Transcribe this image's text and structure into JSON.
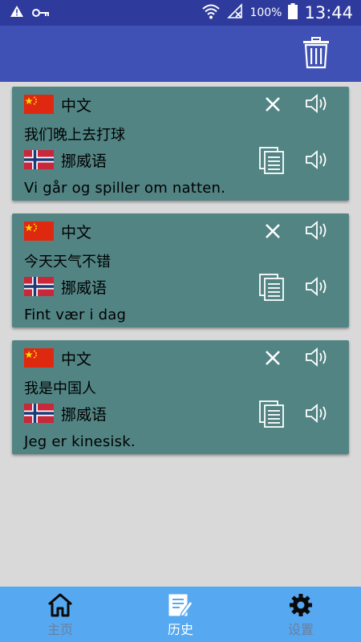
{
  "status_bar": {
    "battery": "100%",
    "time": "13:44",
    "icons": [
      "warning-icon",
      "key-icon",
      "wifi-icon",
      "no-signal-icon",
      "battery-icon"
    ]
  },
  "toolbar": {
    "icons": [
      "trash-icon"
    ]
  },
  "history": [
    {
      "source_lang": "中文",
      "source_text": "我们晚上去打球",
      "target_lang": "挪威语",
      "target_text": "Vi går og spiller om natten."
    },
    {
      "source_lang": "中文",
      "source_text": "今天天气不错",
      "target_lang": "挪威语",
      "target_text": "Fint vær i dag"
    },
    {
      "source_lang": "中文",
      "source_text": "我是中国人",
      "target_lang": "挪威语",
      "target_text": "Jeg er kinesisk."
    }
  ],
  "bottom_nav": {
    "items": [
      {
        "label": "主页",
        "icon": "home-icon",
        "active": false
      },
      {
        "label": "历史",
        "icon": "history-icon",
        "active": true
      },
      {
        "label": "设置",
        "icon": "gear-icon",
        "active": false
      }
    ]
  },
  "colors": {
    "status_bar": "#2e3a9c",
    "toolbar": "#3f51b5",
    "card": "#528484",
    "background": "#d9d9d9",
    "bottom_nav": "#56a8f0"
  }
}
